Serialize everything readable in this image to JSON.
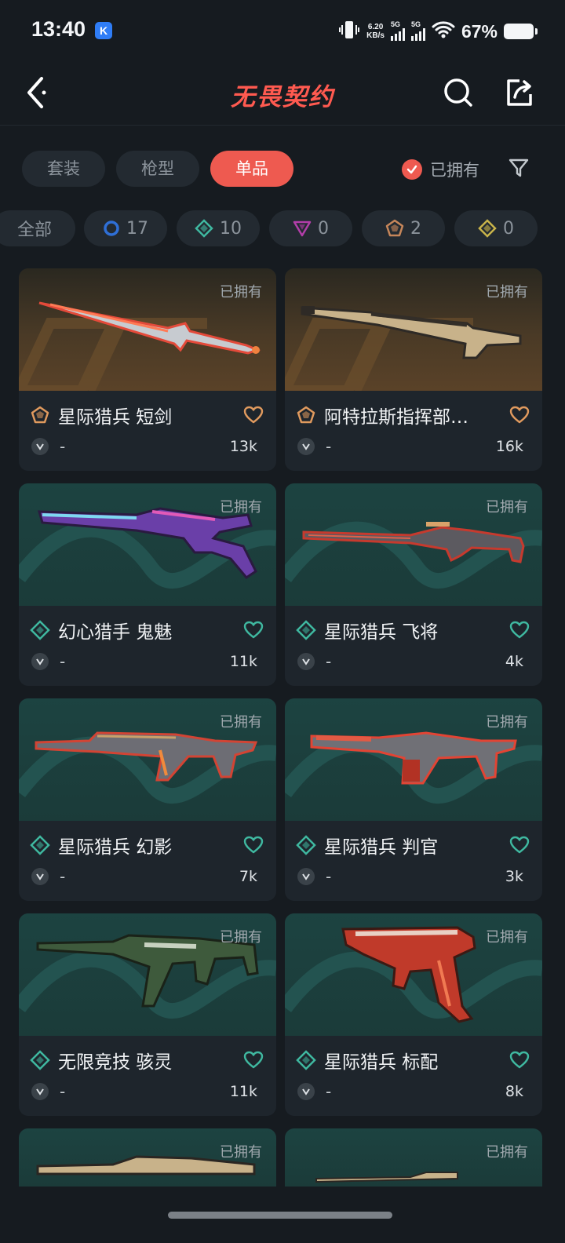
{
  "status_bar": {
    "time": "13:40",
    "app_badge": "K",
    "net_speed_value": "6.20",
    "net_speed_unit": "KB/s",
    "signal1": "5G",
    "signal2": "5G",
    "battery_text": "67%"
  },
  "header": {
    "title": "无畏契约",
    "back_icon": "chevron-left-icon",
    "search_icon": "search-icon",
    "share_icon": "share-icon"
  },
  "tabs": [
    {
      "label": "套装",
      "active": false
    },
    {
      "label": "枪型",
      "active": false
    },
    {
      "label": "单品",
      "active": true
    }
  ],
  "owned_filter": {
    "label": "已拥有",
    "checked": true
  },
  "filter_icon": "funnel-icon",
  "chips": {
    "all": "全部",
    "items": [
      {
        "icon": "ring-blue-icon",
        "count": "17",
        "color": "#2f6fd6"
      },
      {
        "icon": "diamond-teal-icon",
        "count": "10",
        "color": "#3fb8a0"
      },
      {
        "icon": "triangle-purple-icon",
        "count": "0",
        "color": "#b23ea9"
      },
      {
        "icon": "pentagon-orange-icon",
        "count": "2",
        "color": "#c6865a"
      },
      {
        "icon": "diamond-gold-icon",
        "count": "0",
        "color": "#c9b44a"
      }
    ]
  },
  "cards": [
    {
      "name": "星际猎兵 短剑",
      "owned": "已拥有",
      "price": "-",
      "favs": "13k",
      "tier": "pentagon"
    },
    {
      "name": "阿特拉斯指挥部…",
      "owned": "已拥有",
      "price": "-",
      "favs": "16k",
      "tier": "pentagon"
    },
    {
      "name": "幻心猎手 鬼魅",
      "owned": "已拥有",
      "price": "-",
      "favs": "11k",
      "tier": "diamond"
    },
    {
      "name": "星际猎兵 飞将",
      "owned": "已拥有",
      "price": "-",
      "favs": "4k",
      "tier": "diamond"
    },
    {
      "name": "星际猎兵 幻影",
      "owned": "已拥有",
      "price": "-",
      "favs": "7k",
      "tier": "diamond"
    },
    {
      "name": "星际猎兵 判官",
      "owned": "已拥有",
      "price": "-",
      "favs": "3k",
      "tier": "diamond"
    },
    {
      "name": "无限竞技 骇灵",
      "owned": "已拥有",
      "price": "-",
      "favs": "11k",
      "tier": "diamond"
    },
    {
      "name": "星际猎兵 标配",
      "owned": "已拥有",
      "price": "-",
      "favs": "8k",
      "tier": "diamond"
    },
    {
      "name": "",
      "owned": "已拥有",
      "price": "",
      "favs": "",
      "tier": "diamond"
    },
    {
      "name": "",
      "owned": "已拥有",
      "price": "",
      "favs": "",
      "tier": "diamond"
    }
  ],
  "colors": {
    "accent": "#ee5a50",
    "background": "#161b20",
    "card": "#1e252c",
    "tier_pentagon": "#e09a5e",
    "tier_diamond": "#3fb8a0"
  }
}
